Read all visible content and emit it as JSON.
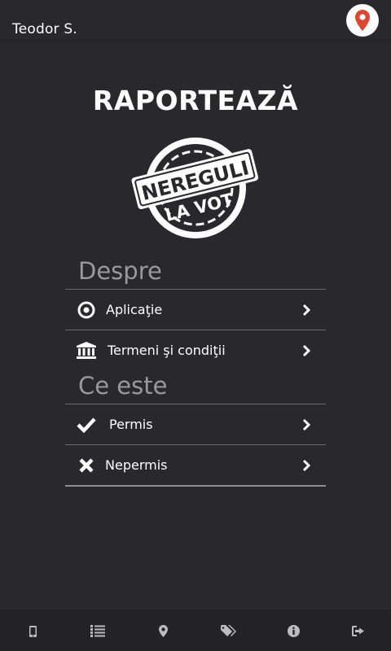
{
  "header": {
    "username": "Teodor S.",
    "map_button_icon": "map-pin-icon",
    "map_pin_color": "#e0452c"
  },
  "main": {
    "title": "RAPORTEAZĂ",
    "logo": {
      "line1": "NEREGULI",
      "line2": "LA VOT"
    },
    "sections": [
      {
        "heading": "Despre",
        "items": [
          {
            "label": "Aplicaţie",
            "icon": "target-icon"
          },
          {
            "label": "Termeni şi condiţii",
            "icon": "institution-icon"
          }
        ]
      },
      {
        "heading": "Ce este",
        "items": [
          {
            "label": "Permis",
            "icon": "check-icon"
          },
          {
            "label": "Nepermis",
            "icon": "times-icon"
          }
        ]
      }
    ]
  },
  "tabbar": {
    "tabs": [
      {
        "icon": "mobile-icon"
      },
      {
        "icon": "list-icon"
      },
      {
        "icon": "map-marker-icon"
      },
      {
        "icon": "tags-icon"
      },
      {
        "icon": "info-icon"
      },
      {
        "icon": "sign-out-icon"
      }
    ]
  },
  "colors": {
    "background": "#29282c",
    "heading_gray": "#9a999d",
    "tabbar_bg": "#242327"
  }
}
